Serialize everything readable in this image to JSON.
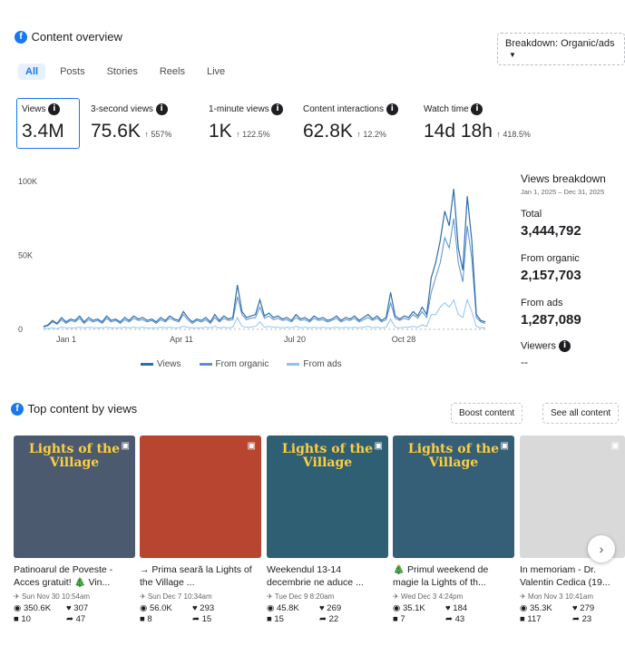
{
  "header": {
    "title": "Content overview",
    "dropdown_label": "Breakdown: Organic/ads"
  },
  "tabs": [
    {
      "label": "All"
    },
    {
      "label": "Posts"
    },
    {
      "label": "Stories"
    },
    {
      "label": "Reels"
    },
    {
      "label": "Live"
    }
  ],
  "metrics": [
    {
      "label": "Views",
      "value": "3.4M",
      "change": ""
    },
    {
      "label": "3-second views",
      "value": "75.6K",
      "change": "↑ 557%"
    },
    {
      "label": "1-minute views",
      "value": "1K",
      "change": "↑ 122.5%"
    },
    {
      "label": "Content interactions",
      "value": "62.8K",
      "change": "↑ 12.2%"
    },
    {
      "label": "Watch time",
      "value": "14d 18h",
      "change": "↑ 418.5%"
    }
  ],
  "chart_data": {
    "type": "line",
    "y_ticks": [
      "100K",
      "50K",
      "0"
    ],
    "x_ticks": [
      "Jan 1",
      "Apr 11",
      "Jul 20",
      "Oct 28"
    ],
    "ylim": [
      0,
      100000
    ],
    "series": [
      {
        "name": "Views",
        "color": "#2d6ea8",
        "values": [
          2000,
          3000,
          6000,
          4000,
          8000,
          5000,
          7000,
          6000,
          9000,
          5000,
          8000,
          6000,
          7000,
          5000,
          9000,
          6000,
          7000,
          5000,
          8000,
          6000,
          9000,
          7000,
          8000,
          6000,
          7000,
          5000,
          8000,
          6000,
          9000,
          7000,
          6000,
          12000,
          8000,
          5000,
          7000,
          6000,
          8000,
          5000,
          10000,
          6000,
          9000,
          7000,
          8000,
          30000,
          12000,
          8000,
          9000,
          10000,
          20000,
          9000,
          11000,
          8000,
          9000,
          7000,
          8000,
          6000,
          10000,
          7000,
          8000,
          6000,
          9000,
          7000,
          8000,
          6000,
          7000,
          9000,
          6000,
          8000,
          7000,
          9000,
          6000,
          8000,
          10000,
          7000,
          9000,
          6000,
          8000,
          25000,
          9000,
          7000,
          9000,
          8000,
          12000,
          9000,
          15000,
          10000,
          35000,
          45000,
          60000,
          80000,
          70000,
          95000,
          55000,
          40000,
          90000,
          60000,
          10000,
          6000,
          5000
        ]
      },
      {
        "name": "From organic",
        "color": "#5b8fcf",
        "values": [
          1500,
          2500,
          5000,
          3500,
          6500,
          4000,
          6000,
          5000,
          7500,
          4000,
          6500,
          5000,
          6000,
          4000,
          7500,
          5000,
          6000,
          4000,
          6500,
          5000,
          7500,
          6000,
          6500,
          5000,
          6000,
          4000,
          6500,
          5000,
          7500,
          6000,
          5000,
          10000,
          6500,
          4000,
          6000,
          5000,
          6500,
          4000,
          8000,
          5000,
          7500,
          6000,
          6500,
          22000,
          10000,
          6500,
          7500,
          8000,
          15000,
          7500,
          9000,
          6500,
          7500,
          6000,
          6500,
          5000,
          8000,
          6000,
          6500,
          5000,
          7500,
          6000,
          6500,
          5000,
          6000,
          7500,
          5000,
          6500,
          6000,
          7500,
          5000,
          6500,
          8000,
          6000,
          7500,
          5000,
          6500,
          18000,
          7500,
          6000,
          7500,
          6500,
          10000,
          7500,
          12000,
          8000,
          25000,
          35000,
          45000,
          62000,
          55000,
          75000,
          45000,
          32000,
          70000,
          48000,
          8000,
          5000,
          4000
        ]
      },
      {
        "name": "From ads",
        "color": "#8fc3ee",
        "values": [
          500,
          500,
          1000,
          500,
          1500,
          1000,
          1000,
          1000,
          1500,
          1000,
          1500,
          1000,
          1000,
          1000,
          1500,
          1000,
          1000,
          1000,
          1500,
          1000,
          1500,
          1000,
          1500,
          1000,
          1000,
          1000,
          1500,
          1000,
          1500,
          1000,
          1000,
          2000,
          1500,
          1000,
          1000,
          1000,
          1500,
          1000,
          2000,
          1000,
          1500,
          1000,
          1500,
          8000,
          2000,
          1500,
          1500,
          2000,
          5000,
          1500,
          2000,
          1500,
          1500,
          1000,
          1500,
          1000,
          2000,
          1000,
          1500,
          1000,
          1500,
          1000,
          1500,
          1000,
          1000,
          1500,
          1000,
          1500,
          1000,
          1500,
          1000,
          1500,
          2000,
          1000,
          1500,
          1000,
          1500,
          7000,
          1500,
          1000,
          1500,
          1500,
          2000,
          1500,
          3000,
          2000,
          10000,
          10000,
          15000,
          18000,
          15000,
          20000,
          10000,
          8000,
          20000,
          12000,
          2000,
          1000,
          1000
        ]
      }
    ]
  },
  "breakdown": {
    "title": "Views breakdown",
    "date_range": "Jan 1, 2025 – Dec 31, 2025",
    "total_label": "Total",
    "total_value": "3,444,792",
    "organic_label": "From organic",
    "organic_value": "2,157,703",
    "ads_label": "From ads",
    "ads_value": "1,287,089",
    "viewers_label": "Viewers",
    "viewers_value": "--"
  },
  "top_content": {
    "title": "Top content by views",
    "boost_label": "Boost content",
    "see_all_label": "See all content",
    "cards": [
      {
        "title": "Patinoarul de Poveste - Acces gratuit! 🎄 Vin...",
        "date": "Sun Nov 30 10:54am",
        "views": "350.6K",
        "likes": "307",
        "comments": "10",
        "shares": "47",
        "thumb_text": "Lights of the Village",
        "bg": "#4b5a6e"
      },
      {
        "title": "→ Prima seară la Lights of the Village ...",
        "date": "Sun Dec 7 10:34am",
        "views": "56.0K",
        "likes": "293",
        "comments": "8",
        "shares": "15",
        "thumb_text": "",
        "bg": "#b8452f"
      },
      {
        "title": "Weekendul 13-14 decembrie ne aduce ...",
        "date": "Tue Dec 9 8:20am",
        "views": "45.8K",
        "likes": "269",
        "comments": "15",
        "shares": "22",
        "thumb_text": "Lights of the Village",
        "bg": "#2f5f73"
      },
      {
        "title": "🎄 Primul weekend de magie la Lights of th...",
        "date": "Wed Dec 3 4:24pm",
        "views": "35.1K",
        "likes": "184",
        "comments": "7",
        "shares": "43",
        "thumb_text": "Lights of the Village",
        "bg": "#355f77"
      },
      {
        "title": "In memoriam - Dr. Valentin Cedica (19...",
        "date": "Mon Nov 3 10:41am",
        "views": "35.3K",
        "likes": "279",
        "comments": "117",
        "shares": "23",
        "thumb_text": "",
        "bg": "#d9d9d9"
      }
    ]
  }
}
